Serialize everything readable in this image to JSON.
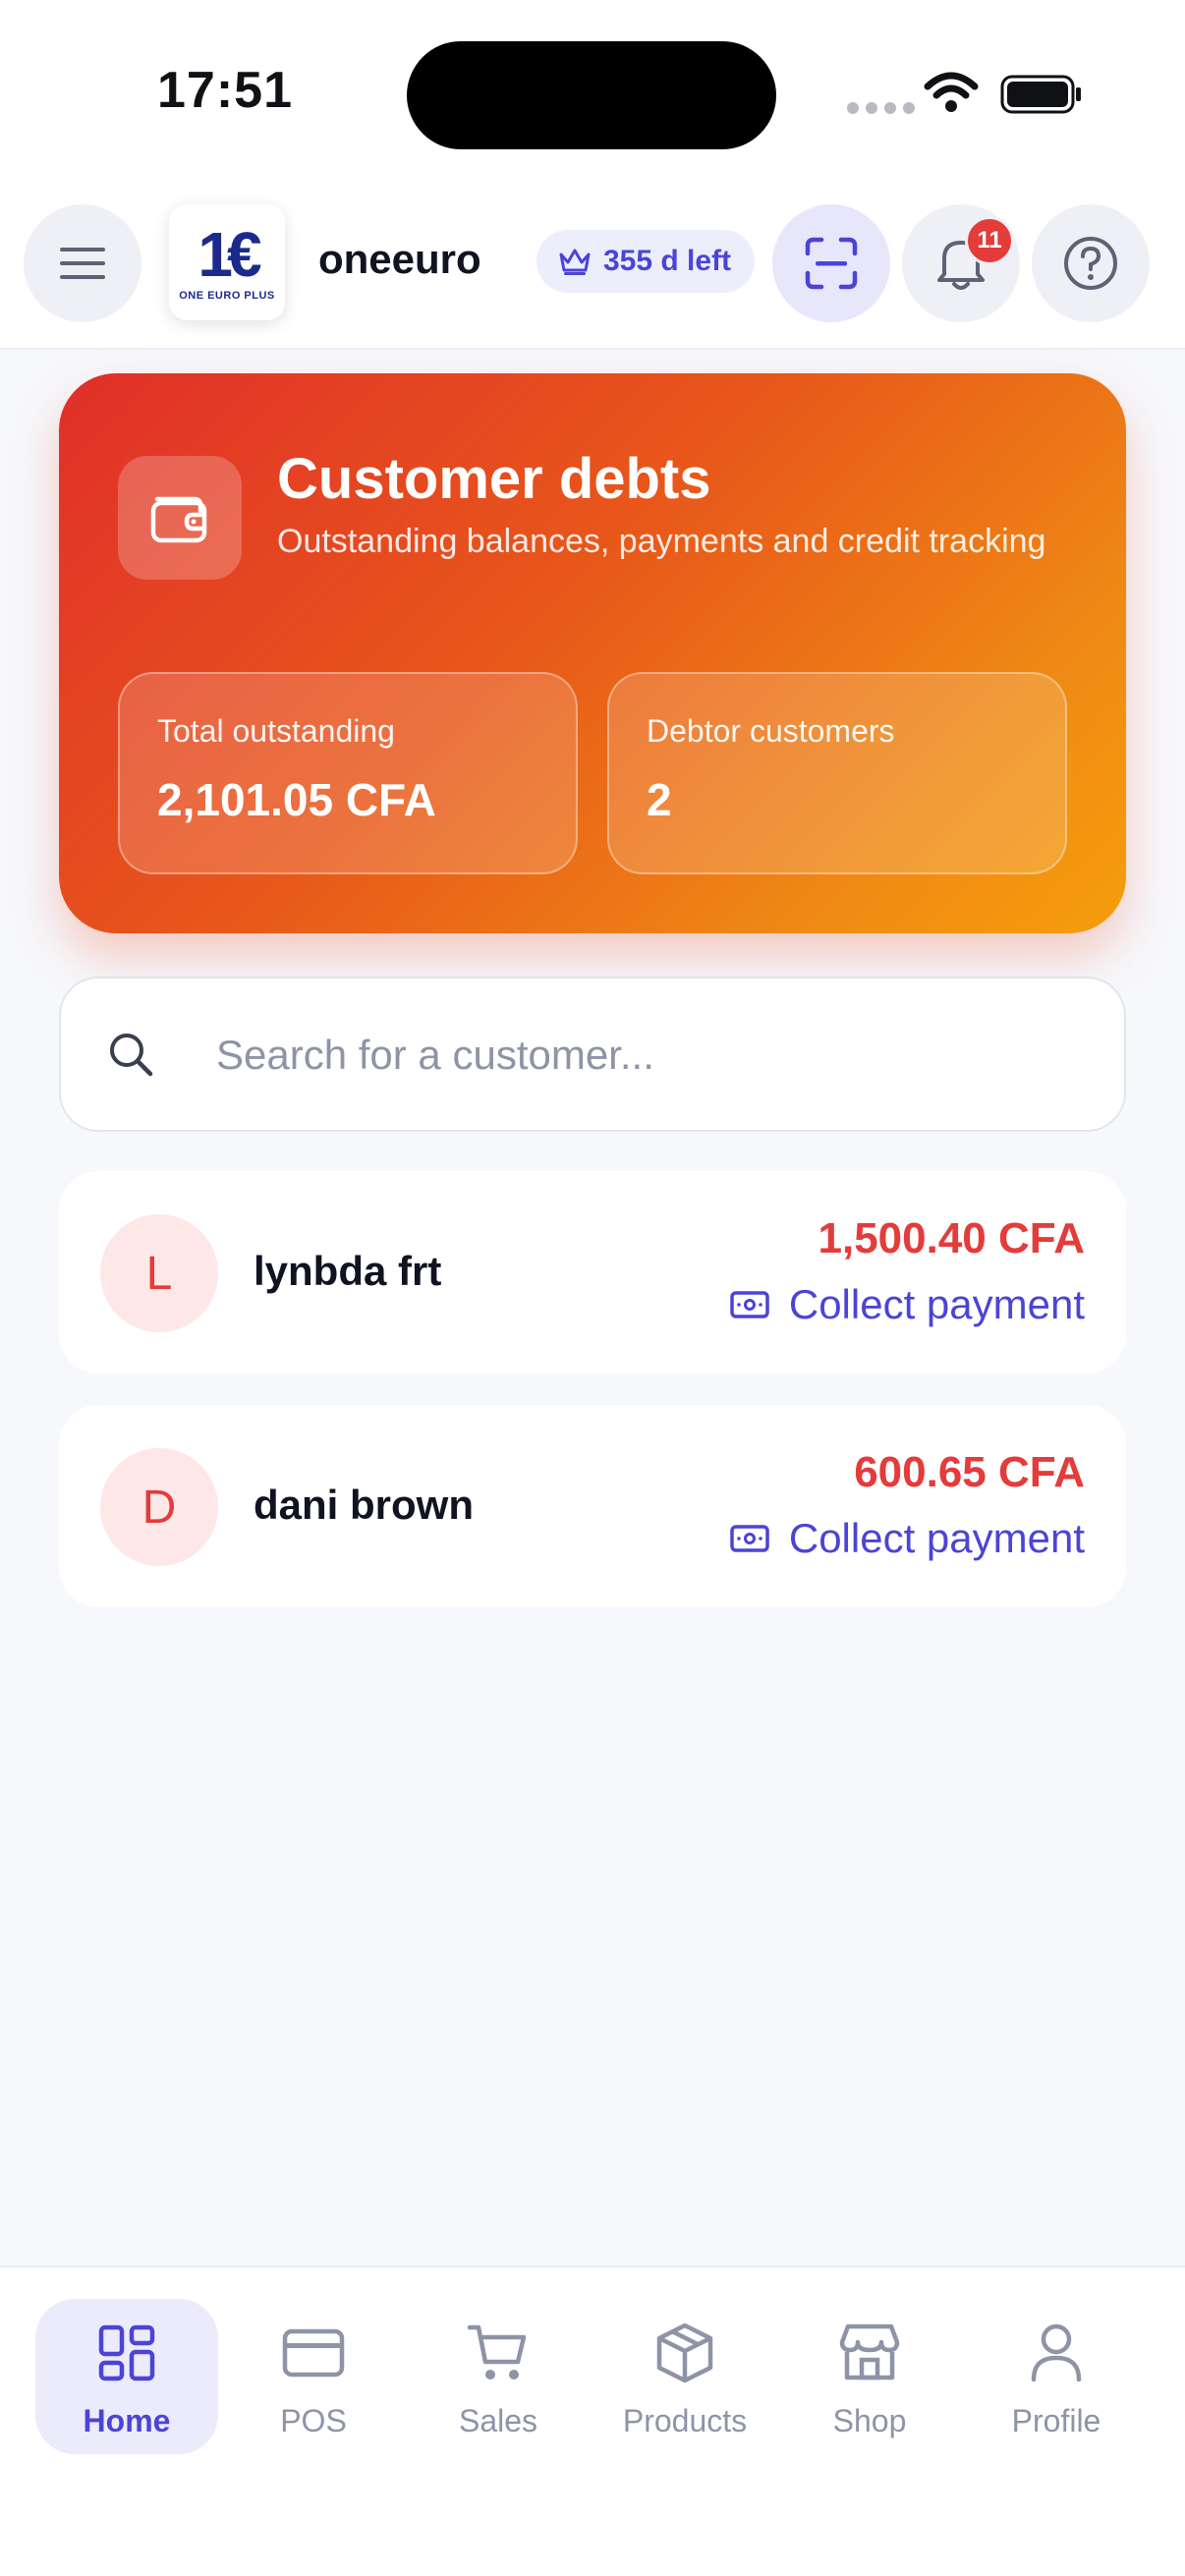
{
  "status": {
    "time": "17:51"
  },
  "header": {
    "shop_name": "oneeuro",
    "trial": "355 d left",
    "notifications": "11",
    "logo": {
      "mark": "1€",
      "caption": "ONE EURO PLUS"
    }
  },
  "hero": {
    "title": "Customer debts",
    "subtitle": "Outstanding balances, payments and credit tracking",
    "stats": [
      {
        "label": "Total outstanding",
        "value": "2,101.05 CFA"
      },
      {
        "label": "Debtor customers",
        "value": "2"
      }
    ]
  },
  "search": {
    "placeholder": "Search for a customer...",
    "value": ""
  },
  "debtors": [
    {
      "initial": "L",
      "name": "lynbda frt",
      "amount": "1,500.40 CFA",
      "action": "Collect payment"
    },
    {
      "initial": "D",
      "name": "dani brown",
      "amount": "600.65 CFA",
      "action": "Collect payment"
    }
  ],
  "nav": [
    {
      "label": "Home",
      "icon": "grid-icon",
      "active": true
    },
    {
      "label": "POS",
      "icon": "card-icon"
    },
    {
      "label": "Sales",
      "icon": "cart-icon"
    },
    {
      "label": "Products",
      "icon": "box-icon"
    },
    {
      "label": "Shop",
      "icon": "store-icon"
    },
    {
      "label": "Profile",
      "icon": "user-icon"
    }
  ],
  "colors": {
    "accent": "#4b44d6",
    "danger": "#e43b3b",
    "hero_start": "#e02f2a",
    "hero_end": "#f59e0b"
  }
}
